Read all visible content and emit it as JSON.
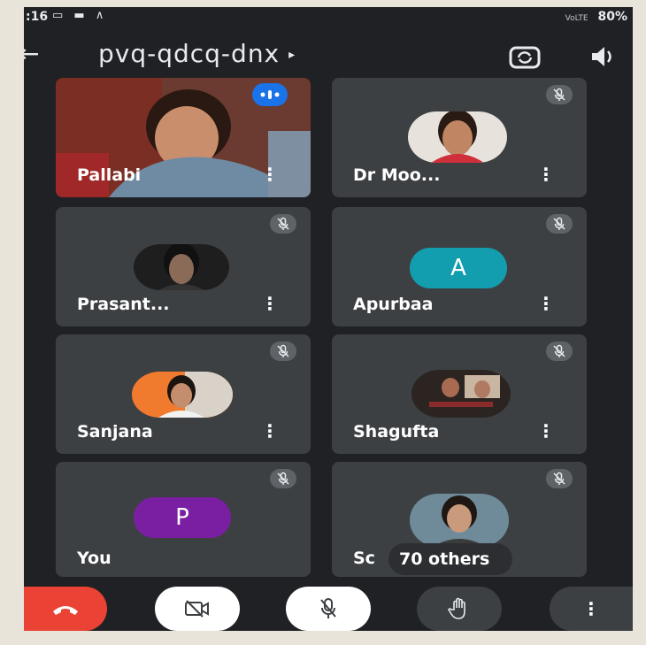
{
  "status_bar": {
    "time": ":16",
    "notif_icons": "▭ ▬ ∧",
    "signal": "VoLTE",
    "battery": "80%"
  },
  "call": {
    "meeting_code": "pvq-qdcq-dnx",
    "caret": "▸"
  },
  "tiles": [
    {
      "name": "Pallabi",
      "menu": "⋮",
      "speaking": true
    },
    {
      "name": "Dr Moo...",
      "menu": "⋮",
      "muted": true
    },
    {
      "name": "Prasant...",
      "menu": "⋮",
      "muted": true
    },
    {
      "name": "Apurbaa",
      "menu": "⋮",
      "muted": true,
      "avatar_letter": "A",
      "avatar_color": "#129eaf"
    },
    {
      "name": "Sanjana",
      "menu": "⋮",
      "muted": true
    },
    {
      "name": "Shagufta",
      "menu": "⋮",
      "muted": true
    },
    {
      "name": "You",
      "muted": true,
      "avatar_letter": "P",
      "avatar_color": "#7b1fa2"
    },
    {
      "name": "Sc",
      "muted": true
    }
  ],
  "others_label": "70 others",
  "controls": {
    "end_color": "#ea4335",
    "more": "⋮"
  },
  "icons": [
    "back-arrow-icon",
    "switch-camera-icon",
    "speaker-icon",
    "mic-off-icon",
    "voice-activity-icon",
    "end-call-icon",
    "camera-off-icon",
    "raise-hand-icon",
    "more-vert-icon"
  ]
}
